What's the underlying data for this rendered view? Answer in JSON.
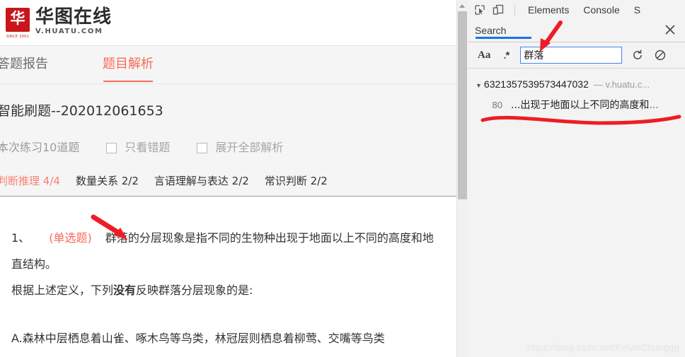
{
  "site": {
    "logo_glyph": "华",
    "logo_since": "SINCE 2001",
    "logo_title": "华图在线",
    "logo_subtitle": "V.HUATU.COM"
  },
  "report_tabs": [
    {
      "label": "答题报告",
      "active": false
    },
    {
      "label": "题目解析",
      "active": true
    }
  ],
  "summary": {
    "quiz_title": "智能刷题--202012061653",
    "count_text": "本次练习10道题",
    "checkboxes": [
      {
        "label": "只看错题",
        "checked": false
      },
      {
        "label": "展开全部解析",
        "checked": false
      }
    ],
    "subjects": [
      {
        "label": "判断推理",
        "score": "4/4",
        "active": true
      },
      {
        "label": "数量关系",
        "score": "2/2",
        "active": false
      },
      {
        "label": "言语理解与表达",
        "score": "2/2",
        "active": false
      },
      {
        "label": "常识判断",
        "score": "2/2",
        "active": false
      }
    ]
  },
  "question": {
    "number": "1、",
    "type": "(单选题)",
    "stem_line1": "群落的分层现象是指不同的生物种出现于地面以上不同的高度和地",
    "stem_line2": "直结构。",
    "prompt_pre": "根据上述定义，下列",
    "prompt_bold": "没有",
    "prompt_post": "反映群落分层现象的是:",
    "option_a": "A.森林中层栖息着山雀、啄木鸟等鸟类，林冠层则栖息着柳莺、交嘴等鸟类"
  },
  "devtools": {
    "toolbar_icons": [
      {
        "name": "inspect-element-icon"
      },
      {
        "name": "device-toolbar-icon"
      }
    ],
    "tabs": [
      {
        "label": "Elements",
        "active": false
      },
      {
        "label": "Console",
        "active": false
      },
      {
        "label": "S",
        "active": false
      }
    ],
    "drawer": {
      "tab_label": "Search",
      "close_icon": "close-icon",
      "accent_color": "#1a73e8"
    },
    "search": {
      "match_case_label": "Aa",
      "regex_label": ".*",
      "query": "群落",
      "placeholder": "",
      "refresh_icon": "refresh-icon",
      "clear_icon": "clear-icon"
    },
    "results": {
      "group_id": "6321357539573447032",
      "group_url": "— v.huatu.c...",
      "line_number": "80",
      "snippet": "...出现于地面以上不同的高度和",
      "snippet_ellipsis": "..."
    }
  },
  "annotations": {
    "arrow_page_color": "#ee1c25",
    "arrow_devtools_color": "#ee1c25",
    "underline_color": "#ee1c25"
  },
  "watermark": "https://blog.csdn.net/KelvinChunggg"
}
